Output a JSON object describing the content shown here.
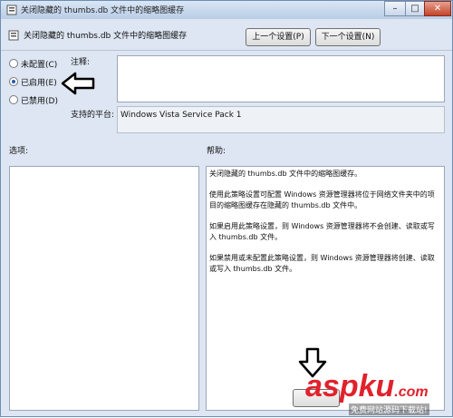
{
  "window": {
    "title": "关闭隐藏的 thumbs.db 文件中的缩略图缓存",
    "minimize": "–",
    "maximize": "□",
    "close": "✕"
  },
  "header": {
    "policy_name": "关闭隐藏的 thumbs.db 文件中的缩略图缓存",
    "prev_button": "上一个设置(P)",
    "next_button": "下一个设置(N)"
  },
  "options": [
    {
      "label": "未配置(C)",
      "checked": false
    },
    {
      "label": "已启用(E)",
      "checked": true
    },
    {
      "label": "已禁用(D)",
      "checked": false
    }
  ],
  "comment_label": "注释:",
  "platform_label": "支持的平台:",
  "platform_value": "Windows Vista Service Pack 1",
  "options_section_label": "选项:",
  "help_section_label": "帮助:",
  "help_paragraphs": [
    "关闭隐藏的 thumbs.db 文件中的缩略图缓存。",
    "使用此策略设置可配置 Windows 资源管理器将位于网络文件夹中的项目的缩略图缓存在隐藏的 thumbs.db 文件中。",
    "如果启用此策略设置，则 Windows 资源管理器将不会创建、读取或写入 thumbs.db 文件。",
    "如果禁用或未配置此策略设置，则 Windows 资源管理器将创建、读取或写入 thumbs.db 文件。"
  ],
  "watermark": {
    "brand": "aspku",
    "suffix": ".com",
    "sub": "免费网站源码下载站!"
  }
}
